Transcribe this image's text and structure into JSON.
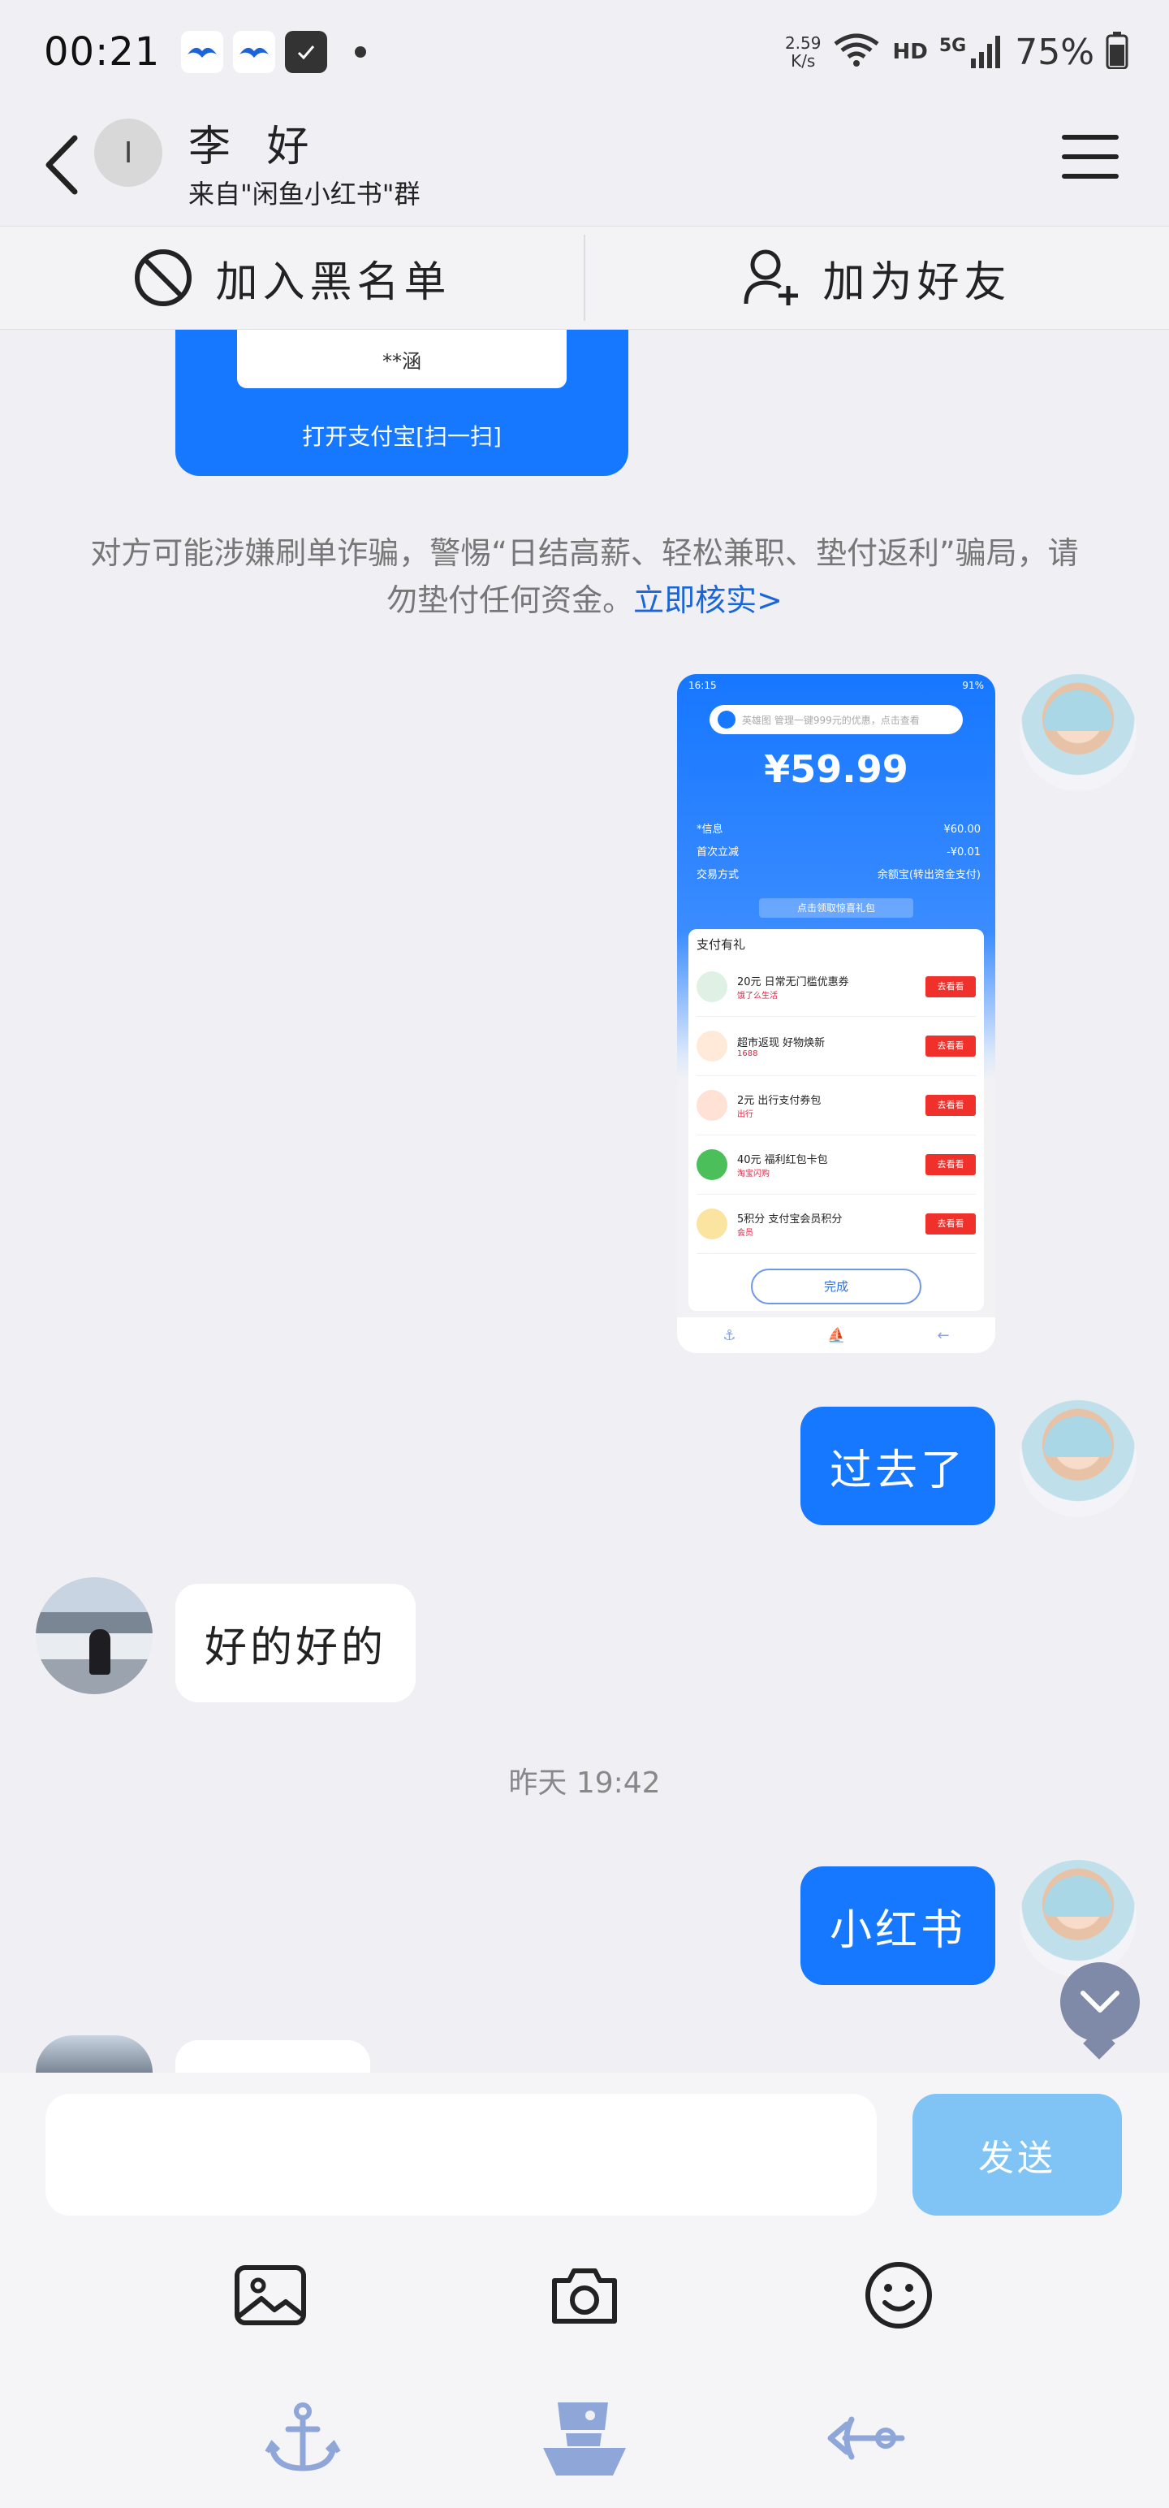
{
  "status_bar": {
    "time": "00:21",
    "net_speed_value": "2.59",
    "net_speed_unit": "K/s",
    "network_label": "HD",
    "signal_label": "5G",
    "battery": "75%"
  },
  "header": {
    "avatar_initial": "I",
    "contact_name": "李 好",
    "contact_source": "来自\"闲鱼小红书\"群"
  },
  "actions": {
    "block_label": "加入黑名单",
    "add_friend_label": "加为好友"
  },
  "qr_card": {
    "masked_name": "**涵",
    "footer_text": "打开支付宝[扫一扫]"
  },
  "warning": {
    "text": "对方可能涉嫌刷单诈骗，警惕“日结高薪、轻松兼职、垫付返利”骗局，请勿垫付任何资金。",
    "link": "立即核实>"
  },
  "screenshot": {
    "status_time": "16:15",
    "status_right": "91%",
    "search_text": "英雄图 管理一键999元的优惠，点击查看",
    "amount": "¥59.99",
    "rows": [
      {
        "label": "*信息",
        "value": "¥60.00"
      },
      {
        "label": "首次立减",
        "value": "-¥0.01"
      },
      {
        "label": "交易方式",
        "value": "余额宝(转出资金支付)"
      }
    ],
    "tip": "点击领取惊喜礼包",
    "panel_title": "支付有礼",
    "offers": [
      {
        "title": "20元 日常无门槛优惠券",
        "tag": "饿了么生活",
        "button": "去看看"
      },
      {
        "title": "超市返现 好物焕新",
        "tag": "1688",
        "button": "去看看"
      },
      {
        "title": "2元 出行支付券包",
        "tag": "出行",
        "button": "去看看"
      },
      {
        "title": "40元 福利红包卡包",
        "tag": "淘宝闪购",
        "button": "去看看"
      },
      {
        "title": "5积分 支付宝会员积分",
        "tag": "会员",
        "button": "去看看"
      }
    ],
    "done_label": "完成"
  },
  "messages": [
    {
      "direction": "out",
      "text": "过去了"
    },
    {
      "direction": "in",
      "text": "好的好的"
    },
    {
      "direction": "out",
      "text": "小红书"
    }
  ],
  "timestamp": "昨天 19:42",
  "composer": {
    "input_value": "",
    "send_label": "发送"
  },
  "icons": {
    "back": "back-arrow-icon",
    "menu": "menu-icon",
    "block": "block-icon",
    "add_friend": "add-friend-icon",
    "image": "image-icon",
    "camera": "camera-icon",
    "emoji": "emoji-icon",
    "anchor": "anchor-icon",
    "ship": "ship-icon",
    "trident": "trident-icon",
    "scroll_down": "chevron-down-icon"
  },
  "colors": {
    "accent": "#1677ff",
    "send_disabled": "#80c4f5",
    "link": "#1a66d8"
  }
}
